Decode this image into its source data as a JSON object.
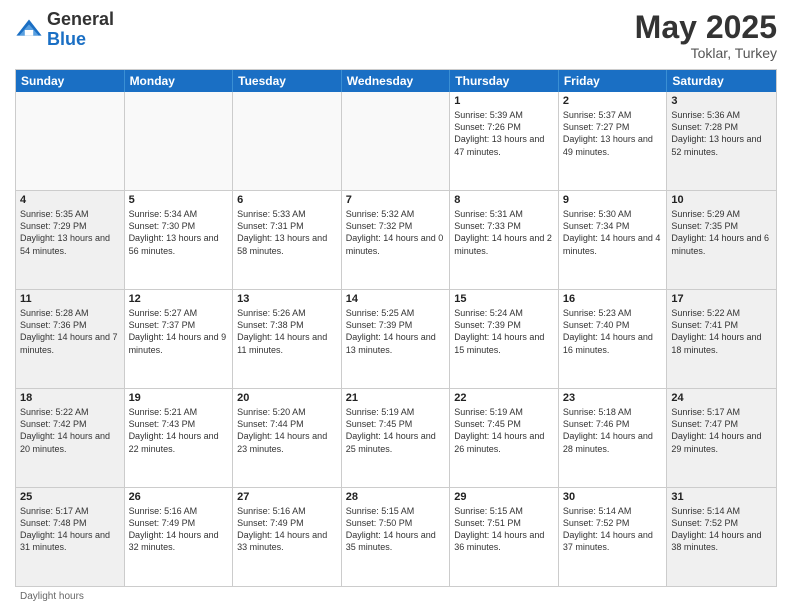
{
  "header": {
    "logo_general": "General",
    "logo_blue": "Blue",
    "month_title": "May 2025",
    "location": "Toklar, Turkey"
  },
  "days_of_week": [
    "Sunday",
    "Monday",
    "Tuesday",
    "Wednesday",
    "Thursday",
    "Friday",
    "Saturday"
  ],
  "weeks": [
    [
      {
        "day": "",
        "empty": true
      },
      {
        "day": "",
        "empty": true
      },
      {
        "day": "",
        "empty": true
      },
      {
        "day": "",
        "empty": true
      },
      {
        "day": "1",
        "sunrise": "5:39 AM",
        "sunset": "7:26 PM",
        "daylight": "13 hours and 47 minutes."
      },
      {
        "day": "2",
        "sunrise": "5:37 AM",
        "sunset": "7:27 PM",
        "daylight": "13 hours and 49 minutes."
      },
      {
        "day": "3",
        "sunrise": "5:36 AM",
        "sunset": "7:28 PM",
        "daylight": "13 hours and 52 minutes.",
        "shaded": true
      }
    ],
    [
      {
        "day": "4",
        "sunrise": "5:35 AM",
        "sunset": "7:29 PM",
        "daylight": "13 hours and 54 minutes.",
        "shaded": true
      },
      {
        "day": "5",
        "sunrise": "5:34 AM",
        "sunset": "7:30 PM",
        "daylight": "13 hours and 56 minutes."
      },
      {
        "day": "6",
        "sunrise": "5:33 AM",
        "sunset": "7:31 PM",
        "daylight": "13 hours and 58 minutes."
      },
      {
        "day": "7",
        "sunrise": "5:32 AM",
        "sunset": "7:32 PM",
        "daylight": "14 hours and 0 minutes."
      },
      {
        "day": "8",
        "sunrise": "5:31 AM",
        "sunset": "7:33 PM",
        "daylight": "14 hours and 2 minutes."
      },
      {
        "day": "9",
        "sunrise": "5:30 AM",
        "sunset": "7:34 PM",
        "daylight": "14 hours and 4 minutes."
      },
      {
        "day": "10",
        "sunrise": "5:29 AM",
        "sunset": "7:35 PM",
        "daylight": "14 hours and 6 minutes.",
        "shaded": true
      }
    ],
    [
      {
        "day": "11",
        "sunrise": "5:28 AM",
        "sunset": "7:36 PM",
        "daylight": "14 hours and 7 minutes.",
        "shaded": true
      },
      {
        "day": "12",
        "sunrise": "5:27 AM",
        "sunset": "7:37 PM",
        "daylight": "14 hours and 9 minutes."
      },
      {
        "day": "13",
        "sunrise": "5:26 AM",
        "sunset": "7:38 PM",
        "daylight": "14 hours and 11 minutes."
      },
      {
        "day": "14",
        "sunrise": "5:25 AM",
        "sunset": "7:39 PM",
        "daylight": "14 hours and 13 minutes."
      },
      {
        "day": "15",
        "sunrise": "5:24 AM",
        "sunset": "7:39 PM",
        "daylight": "14 hours and 15 minutes."
      },
      {
        "day": "16",
        "sunrise": "5:23 AM",
        "sunset": "7:40 PM",
        "daylight": "14 hours and 16 minutes."
      },
      {
        "day": "17",
        "sunrise": "5:22 AM",
        "sunset": "7:41 PM",
        "daylight": "14 hours and 18 minutes.",
        "shaded": true
      }
    ],
    [
      {
        "day": "18",
        "sunrise": "5:22 AM",
        "sunset": "7:42 PM",
        "daylight": "14 hours and 20 minutes.",
        "shaded": true
      },
      {
        "day": "19",
        "sunrise": "5:21 AM",
        "sunset": "7:43 PM",
        "daylight": "14 hours and 22 minutes."
      },
      {
        "day": "20",
        "sunrise": "5:20 AM",
        "sunset": "7:44 PM",
        "daylight": "14 hours and 23 minutes."
      },
      {
        "day": "21",
        "sunrise": "5:19 AM",
        "sunset": "7:45 PM",
        "daylight": "14 hours and 25 minutes."
      },
      {
        "day": "22",
        "sunrise": "5:19 AM",
        "sunset": "7:45 PM",
        "daylight": "14 hours and 26 minutes."
      },
      {
        "day": "23",
        "sunrise": "5:18 AM",
        "sunset": "7:46 PM",
        "daylight": "14 hours and 28 minutes."
      },
      {
        "day": "24",
        "sunrise": "5:17 AM",
        "sunset": "7:47 PM",
        "daylight": "14 hours and 29 minutes.",
        "shaded": true
      }
    ],
    [
      {
        "day": "25",
        "sunrise": "5:17 AM",
        "sunset": "7:48 PM",
        "daylight": "14 hours and 31 minutes.",
        "shaded": true
      },
      {
        "day": "26",
        "sunrise": "5:16 AM",
        "sunset": "7:49 PM",
        "daylight": "14 hours and 32 minutes."
      },
      {
        "day": "27",
        "sunrise": "5:16 AM",
        "sunset": "7:49 PM",
        "daylight": "14 hours and 33 minutes."
      },
      {
        "day": "28",
        "sunrise": "5:15 AM",
        "sunset": "7:50 PM",
        "daylight": "14 hours and 35 minutes."
      },
      {
        "day": "29",
        "sunrise": "5:15 AM",
        "sunset": "7:51 PM",
        "daylight": "14 hours and 36 minutes."
      },
      {
        "day": "30",
        "sunrise": "5:14 AM",
        "sunset": "7:52 PM",
        "daylight": "14 hours and 37 minutes."
      },
      {
        "day": "31",
        "sunrise": "5:14 AM",
        "sunset": "7:52 PM",
        "daylight": "14 hours and 38 minutes.",
        "shaded": true
      }
    ]
  ],
  "footer": {
    "daylight_label": "Daylight hours"
  }
}
